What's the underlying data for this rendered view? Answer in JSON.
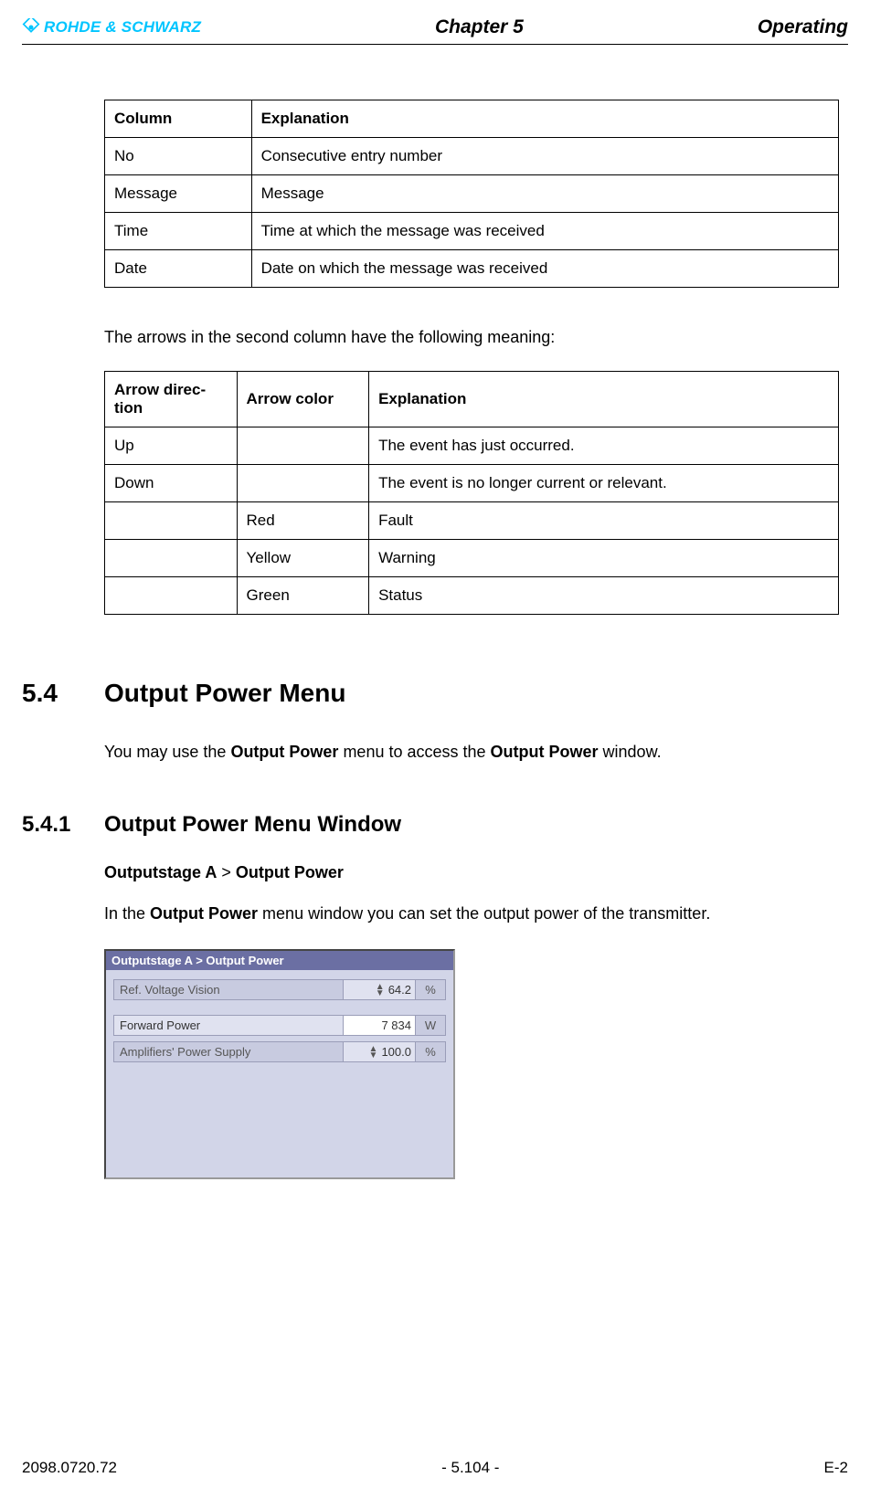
{
  "header": {
    "brand": "ROHDE & SCHWARZ",
    "chapter": "Chapter 5",
    "section": "Operating"
  },
  "table1": {
    "headers": {
      "c1": "Column",
      "c2": "Explanation"
    },
    "rows": [
      {
        "c1": "No",
        "c2": "Consecutive entry number"
      },
      {
        "c1": "Message",
        "c2": "Message"
      },
      {
        "c1": "Time",
        "c2": "Time at which the message was received"
      },
      {
        "c1": "Date",
        "c2": "Date on which the message was received"
      }
    ]
  },
  "para1": "The arrows in the second column have the following meaning:",
  "table2": {
    "headers": {
      "c1": "Arrow direc­tion",
      "c2": "Arrow color",
      "c3": "Explanation"
    },
    "rows": [
      {
        "c1": "Up",
        "c2": "",
        "c3": "The event has just occurred."
      },
      {
        "c1": "Down",
        "c2": "",
        "c3": "The event is no longer current or relevant."
      },
      {
        "c1": "",
        "c2": "Red",
        "c3": "Fault"
      },
      {
        "c1": "",
        "c2": "Yellow",
        "c3": "Warning"
      },
      {
        "c1": "",
        "c2": "Green",
        "c3": "Status"
      }
    ]
  },
  "sec": {
    "num": "5.4",
    "title": "Output Power Menu"
  },
  "intro": {
    "p1a": "You may use the ",
    "p1b": "Output Power",
    "p1c": " menu to access the ",
    "p1d": "Output Power",
    "p1e": " window."
  },
  "sub": {
    "num": "5.4.1",
    "title": "Output Power Menu Window"
  },
  "path": {
    "a": "Outputstage A",
    "sep": " > ",
    "b": "Output Power"
  },
  "desc": {
    "a": "In the ",
    "b": "Output Power",
    "c": " menu window you can set the output power of the transmitter."
  },
  "ui": {
    "title": "Outputstage A  > Output Power",
    "rows": [
      {
        "label": "Ref. Voltage Vision",
        "value": "64.2",
        "unit": "%",
        "spin": true,
        "light": false
      },
      {
        "label": "Forward Power",
        "value": "7 834",
        "unit": "W",
        "spin": false,
        "light": true
      },
      {
        "label": "Amplifiers' Power Supply",
        "value": "100.0",
        "unit": "%",
        "spin": true,
        "light": false
      }
    ]
  },
  "footer": {
    "left": "2098.0720.72",
    "center": "- 5.104 -",
    "right": "E-2"
  }
}
